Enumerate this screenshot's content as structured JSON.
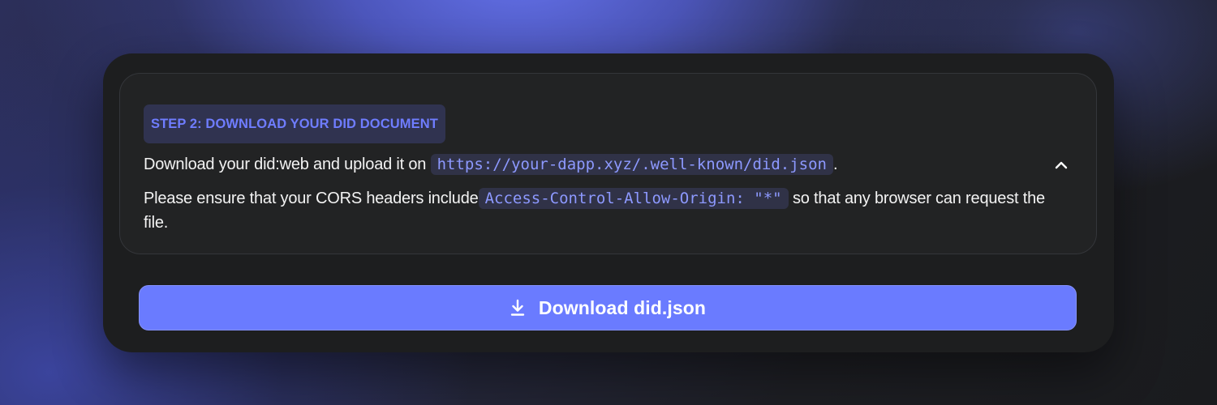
{
  "step": {
    "badge_label": "STEP 2: DOWNLOAD YOUR DID DOCUMENT",
    "para1_text": "Download your did:web and upload it on ",
    "para1_code": "https://your-dapp.xyz/.well-known/did.json",
    "para1_suffix": ".",
    "para2_text": "Please ensure that your CORS headers include",
    "para2_code": "Access-Control-Allow-Origin: \"*\"",
    "para2_suffix": " so that any browser can request the file.",
    "collapse_icon": "chevron-up-icon"
  },
  "download_button": {
    "label": "Download did.json",
    "icon": "download-icon"
  },
  "colors": {
    "accent": "#6a7bff",
    "code_text": "#8d99ff",
    "badge_bg": "#303350",
    "card_bg": "#1d1e1f"
  }
}
